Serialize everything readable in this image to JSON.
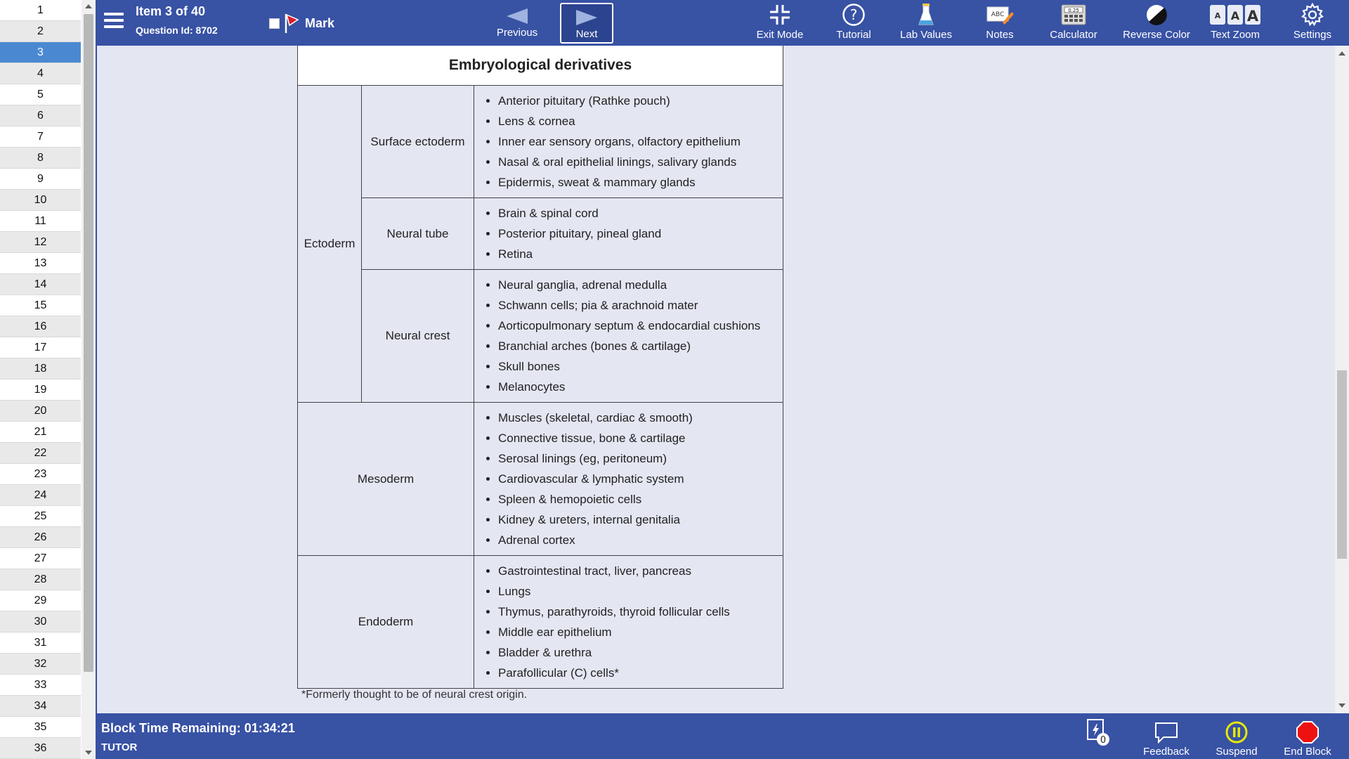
{
  "question_list": {
    "items": [
      "1",
      "2",
      "3",
      "4",
      "5",
      "6",
      "7",
      "8",
      "9",
      "10",
      "11",
      "12",
      "13",
      "14",
      "15",
      "16",
      "17",
      "18",
      "19",
      "20",
      "21",
      "22",
      "23",
      "24",
      "25",
      "26",
      "27",
      "28",
      "29",
      "30",
      "31",
      "32",
      "33",
      "34",
      "35",
      "36"
    ],
    "active_index": 2
  },
  "header": {
    "item_label": "Item 3 of 40",
    "question_id": "Question Id: 8702",
    "mark_label": "Mark",
    "previous_label": "Previous",
    "next_label": "Next"
  },
  "toolbar": {
    "exit_mode": "Exit Mode",
    "tutorial": "Tutorial",
    "lab_values": "Lab Values",
    "notes": "Notes",
    "calculator": "Calculator",
    "calculator_display": "0.25",
    "notes_badge": "ABC",
    "reverse_color": "Reverse Color",
    "text_zoom": "Text Zoom",
    "settings": "Settings"
  },
  "table": {
    "title": "Embryological derivatives",
    "ectoderm_label": "Ectoderm",
    "rows": [
      {
        "sub": "Surface ectoderm",
        "items": [
          "Anterior pituitary (Rathke pouch)",
          "Lens & cornea",
          "Inner ear sensory organs, olfactory epithelium",
          "Nasal & oral epithelial linings, salivary glands",
          "Epidermis, sweat & mammary glands"
        ]
      },
      {
        "sub": "Neural tube",
        "items": [
          "Brain & spinal cord",
          "Posterior pituitary, pineal gland",
          "Retina"
        ]
      },
      {
        "sub": "Neural crest",
        "items": [
          "Neural ganglia, adrenal medulla",
          "Schwann cells; pia & arachnoid mater",
          "Aorticopulmonary septum & endocardial cushions",
          "Branchial arches (bones & cartilage)",
          "Skull bones",
          "Melanocytes"
        ]
      }
    ],
    "mesoderm": {
      "label": "Mesoderm",
      "items": [
        "Muscles (skeletal, cardiac & smooth)",
        "Connective tissue, bone & cartilage",
        "Serosal linings (eg, peritoneum)",
        "Cardiovascular & lymphatic system",
        "Spleen & hemopoietic cells",
        "Kidney & ureters, internal genitalia",
        "Adrenal cortex"
      ]
    },
    "endoderm": {
      "label": "Endoderm",
      "items": [
        "Gastrointestinal tract, liver, pancreas",
        "Lungs",
        "Thymus, parathyroids, thyroid follicular cells",
        "Middle ear epithelium",
        "Bladder & urethra",
        "Parafollicular (C) cells*"
      ]
    },
    "footnote": "*Formerly thought to be of neural crest origin."
  },
  "footer": {
    "block_time": "Block Time Remaining: 01:34:21",
    "mode": "TUTOR",
    "flash_count": "0",
    "feedback": "Feedback",
    "suspend": "Suspend",
    "end_block": "End Block"
  },
  "colors": {
    "bar": "#3852a4",
    "content_bg": "#e4e6f2",
    "active_item": "#4a89d2",
    "mark_flag": "#d81e2a",
    "suspend": "#e8e800",
    "end_block": "#ee1111"
  }
}
